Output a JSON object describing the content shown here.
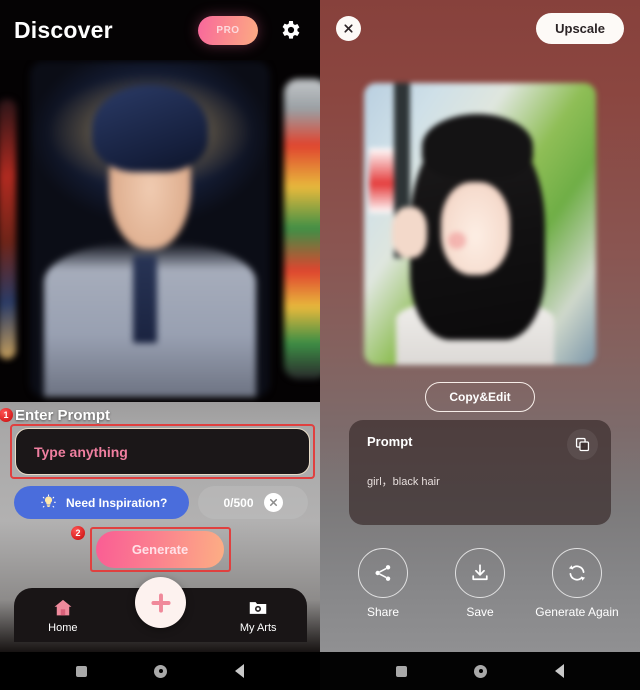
{
  "left_screen": {
    "header": {
      "title": "Discover",
      "pro_label": "PRO",
      "gear_icon": "gear-icon"
    },
    "carousel": {
      "items": [
        "artwork-card-prev",
        "artwork-card-main",
        "artwork-card-next"
      ]
    },
    "prompt_section": {
      "step_badge": "1",
      "label": "Enter Prompt",
      "input_placeholder": "Type anything",
      "input_value": ""
    },
    "inspiration": {
      "label": "Need Inspiration?",
      "bulb_icon": "lightbulb-icon",
      "counter": "0/500",
      "clear_icon": "close-icon"
    },
    "generate": {
      "step_badge": "2",
      "label": "Generate"
    },
    "bottom_nav": {
      "items": [
        {
          "label": "Home",
          "icon": "home-icon"
        },
        {
          "label": "My Arts",
          "icon": "photo-folder-icon"
        }
      ],
      "fab_icon": "plus-icon"
    }
  },
  "right_screen": {
    "header": {
      "close_icon": "close-icon",
      "upscale_label": "Upscale"
    },
    "preview": {
      "image_name": "generated-artwork-preview"
    },
    "copy_edit_label": "Copy&Edit",
    "prompt_card": {
      "title": "Prompt",
      "text": "girl，black hair",
      "copy_icon": "copy-icon"
    },
    "actions": [
      {
        "label": "Share",
        "icon": "share-icon"
      },
      {
        "label": "Save",
        "icon": "download-icon"
      },
      {
        "label": "Generate\nAgain",
        "icon": "refresh-icon"
      }
    ]
  },
  "system_nav": {
    "buttons": [
      "recents-square-icon",
      "home-circle-icon",
      "back-chevron-icon"
    ]
  },
  "colors": {
    "pro_gradient_start": "#f8679c",
    "pro_gradient_end": "#fbab83",
    "generate_gradient_start": "#fa5d94",
    "generate_gradient_end": "#fcae84",
    "annotation_red": "#e0403f",
    "inspire_blue": "#4a6ddc",
    "placeholder_pink": "#f07fa0",
    "right_bg_top": "#87413c",
    "right_bg_bottom": "#909092"
  }
}
